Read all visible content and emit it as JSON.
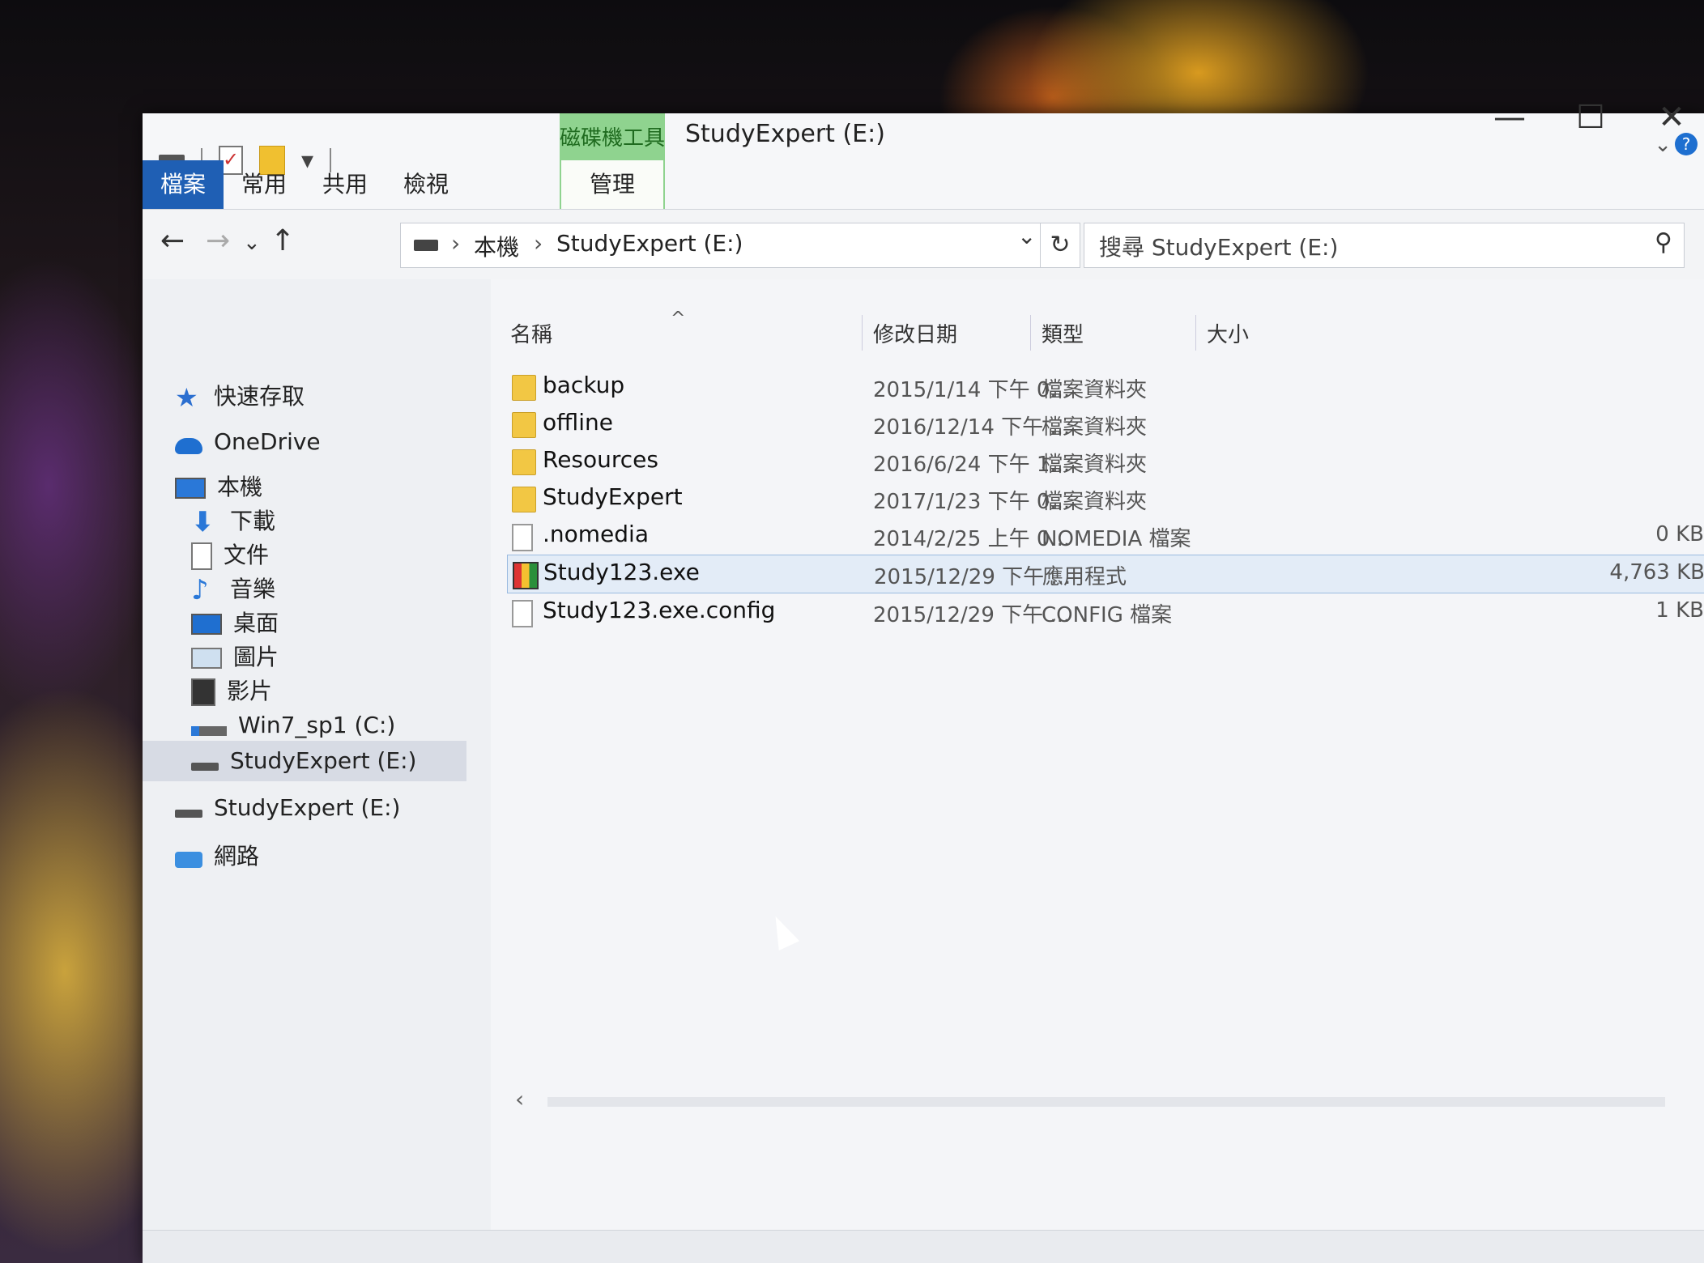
{
  "window": {
    "title": "StudyExpert (E:)",
    "context_tab_group": "磁碟機工具",
    "controls": {
      "minimize": "—",
      "maximize": "☐",
      "close": "✕"
    }
  },
  "ribbon": {
    "tabs": [
      {
        "label": "檔案"
      },
      {
        "label": "常用"
      },
      {
        "label": "共用"
      },
      {
        "label": "檢視"
      },
      {
        "label": "管理"
      }
    ]
  },
  "address": {
    "crumbs": [
      "本機",
      "StudyExpert (E:)"
    ],
    "separator": "›",
    "search_placeholder": "搜尋 StudyExpert (E:)"
  },
  "nav_pane": {
    "items": [
      {
        "label": "快速存取",
        "icon": "star-icon"
      },
      {
        "label": "OneDrive",
        "icon": "cloud-icon"
      },
      {
        "label": "本機",
        "icon": "computer-icon"
      },
      {
        "label": "下載",
        "icon": "download-icon"
      },
      {
        "label": "文件",
        "icon": "document-icon"
      },
      {
        "label": "音樂",
        "icon": "music-icon"
      },
      {
        "label": "桌面",
        "icon": "desktop-icon"
      },
      {
        "label": "圖片",
        "icon": "pictures-icon"
      },
      {
        "label": "影片",
        "icon": "video-icon"
      },
      {
        "label": "Win7_sp1 (C:)",
        "icon": "drive-icon"
      },
      {
        "label": "StudyExpert (E:)",
        "icon": "drive-icon",
        "selected": true
      },
      {
        "label": "StudyExpert (E:)",
        "icon": "drive-icon"
      },
      {
        "label": "網路",
        "icon": "network-icon"
      }
    ]
  },
  "file_list": {
    "columns": {
      "name": "名稱",
      "modified": "修改日期",
      "type": "類型",
      "size": "大小"
    },
    "sort_indicator": "^",
    "rows": [
      {
        "name": "backup",
        "modified": "2015/1/14 下午 0...",
        "type": "檔案資料夾",
        "size": "",
        "icon": "folder-icon"
      },
      {
        "name": "offline",
        "modified": "2016/12/14 下午 ...",
        "type": "檔案資料夾",
        "size": "",
        "icon": "folder-icon"
      },
      {
        "name": "Resources",
        "modified": "2016/6/24 下午 1...",
        "type": "檔案資料夾",
        "size": "",
        "icon": "folder-icon"
      },
      {
        "name": "StudyExpert",
        "modified": "2017/1/23 下午 0...",
        "type": "檔案資料夾",
        "size": "",
        "icon": "folder-icon"
      },
      {
        "name": ".nomedia",
        "modified": "2014/2/25 上午 0...",
        "type": "NOMEDIA 檔案",
        "size": "0 KB",
        "icon": "file-icon"
      },
      {
        "name": "Study123.exe",
        "modified": "2015/12/29 下午 ...",
        "type": "應用程式",
        "size": "4,763 KB",
        "icon": "exe-icon",
        "selected": true
      },
      {
        "name": "Study123.exe.config",
        "modified": "2015/12/29 下午 ...",
        "type": "CONFIG 檔案",
        "size": "1 KB",
        "icon": "file-icon"
      }
    ]
  },
  "scroll": {
    "left_arrow": "‹"
  }
}
